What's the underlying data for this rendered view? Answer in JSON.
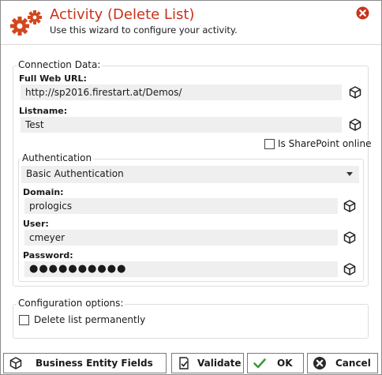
{
  "header": {
    "title": "Activity (Delete List)",
    "subtitle": "Use this wizard to configure your activity."
  },
  "connection": {
    "legend": "Connection Data:",
    "web_url_label": "Full Web URL:",
    "web_url_value": "http://sp2016.firestart.at/Demos/",
    "listname_label": "Listname:",
    "listname_value": "Test",
    "sharepoint_online_label": "Is SharePoint online",
    "sharepoint_online_checked": false
  },
  "authentication": {
    "legend": "Authentication",
    "selected": "Basic Authentication",
    "domain_label": "Domain:",
    "domain_value": "prologics",
    "user_label": "User:",
    "user_value": "cmeyer",
    "password_label": "Password:",
    "password_value": "●●●●●●●●●●"
  },
  "configuration": {
    "legend": "Configuration options:",
    "delete_permanently_label": "Delete list permanently",
    "delete_permanently_checked": false
  },
  "footer": {
    "business_entity_label": "Business Entity Fields",
    "validate_label": "Validate",
    "ok_label": "OK",
    "cancel_label": "Cancel"
  },
  "colors": {
    "accent": "#c8331a",
    "ok_green": "#3c9a3c",
    "input_bg": "#efefef"
  },
  "icons": [
    "gear-icon",
    "close-icon",
    "cube-icon",
    "check-icon",
    "cancel-icon",
    "validate-icon"
  ]
}
